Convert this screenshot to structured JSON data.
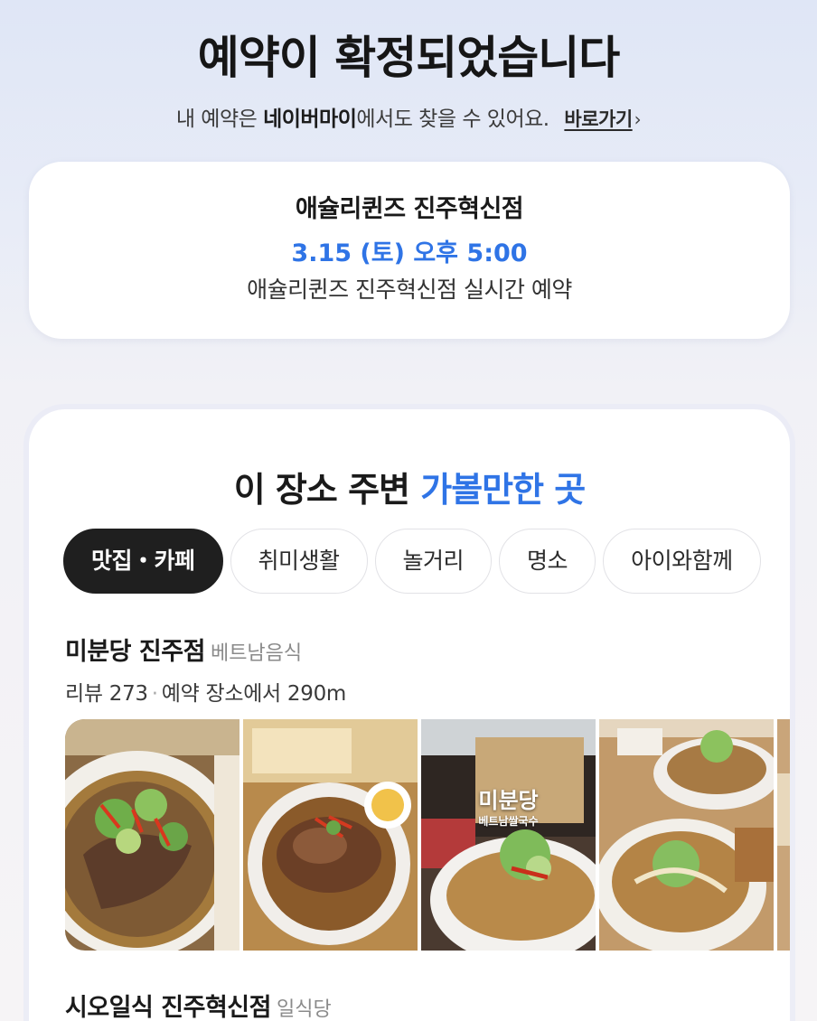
{
  "header": {
    "title": "예약이 확정되었습니다",
    "sub_prefix": "내 예약은 ",
    "sub_bold": "네이버마이",
    "sub_suffix": "에서도 찾을 수 있어요.",
    "link_label": "바로가기",
    "link_chevron": "›"
  },
  "reservation": {
    "place_name": "애슐리퀸즈 진주혁신점",
    "datetime": "3.15 (토) 오후 5:00",
    "type": "애슐리퀸즈 진주혁신점 실시간 예약"
  },
  "nearby": {
    "title_prefix": "이 장소 주변 ",
    "title_highlight": "가볼만한 곳",
    "tabs": [
      "맛집・카페",
      "취미생활",
      "놀거리",
      "명소",
      "아이와함께"
    ],
    "active_tab": 0,
    "places": [
      {
        "name": "미분당 진주점",
        "category": "베트남음식",
        "reviews": "리뷰 273",
        "separator": "·",
        "distance": "예약 장소에서 290m",
        "photo_overlay_name": "미분당",
        "photo_overlay_sub": "베트남쌀국수"
      },
      {
        "name": "시오일식 진주혁신점",
        "category": "일식당"
      }
    ]
  },
  "colors": {
    "accent": "#2f74e6",
    "active_tab_bg": "#1f1f1f"
  }
}
